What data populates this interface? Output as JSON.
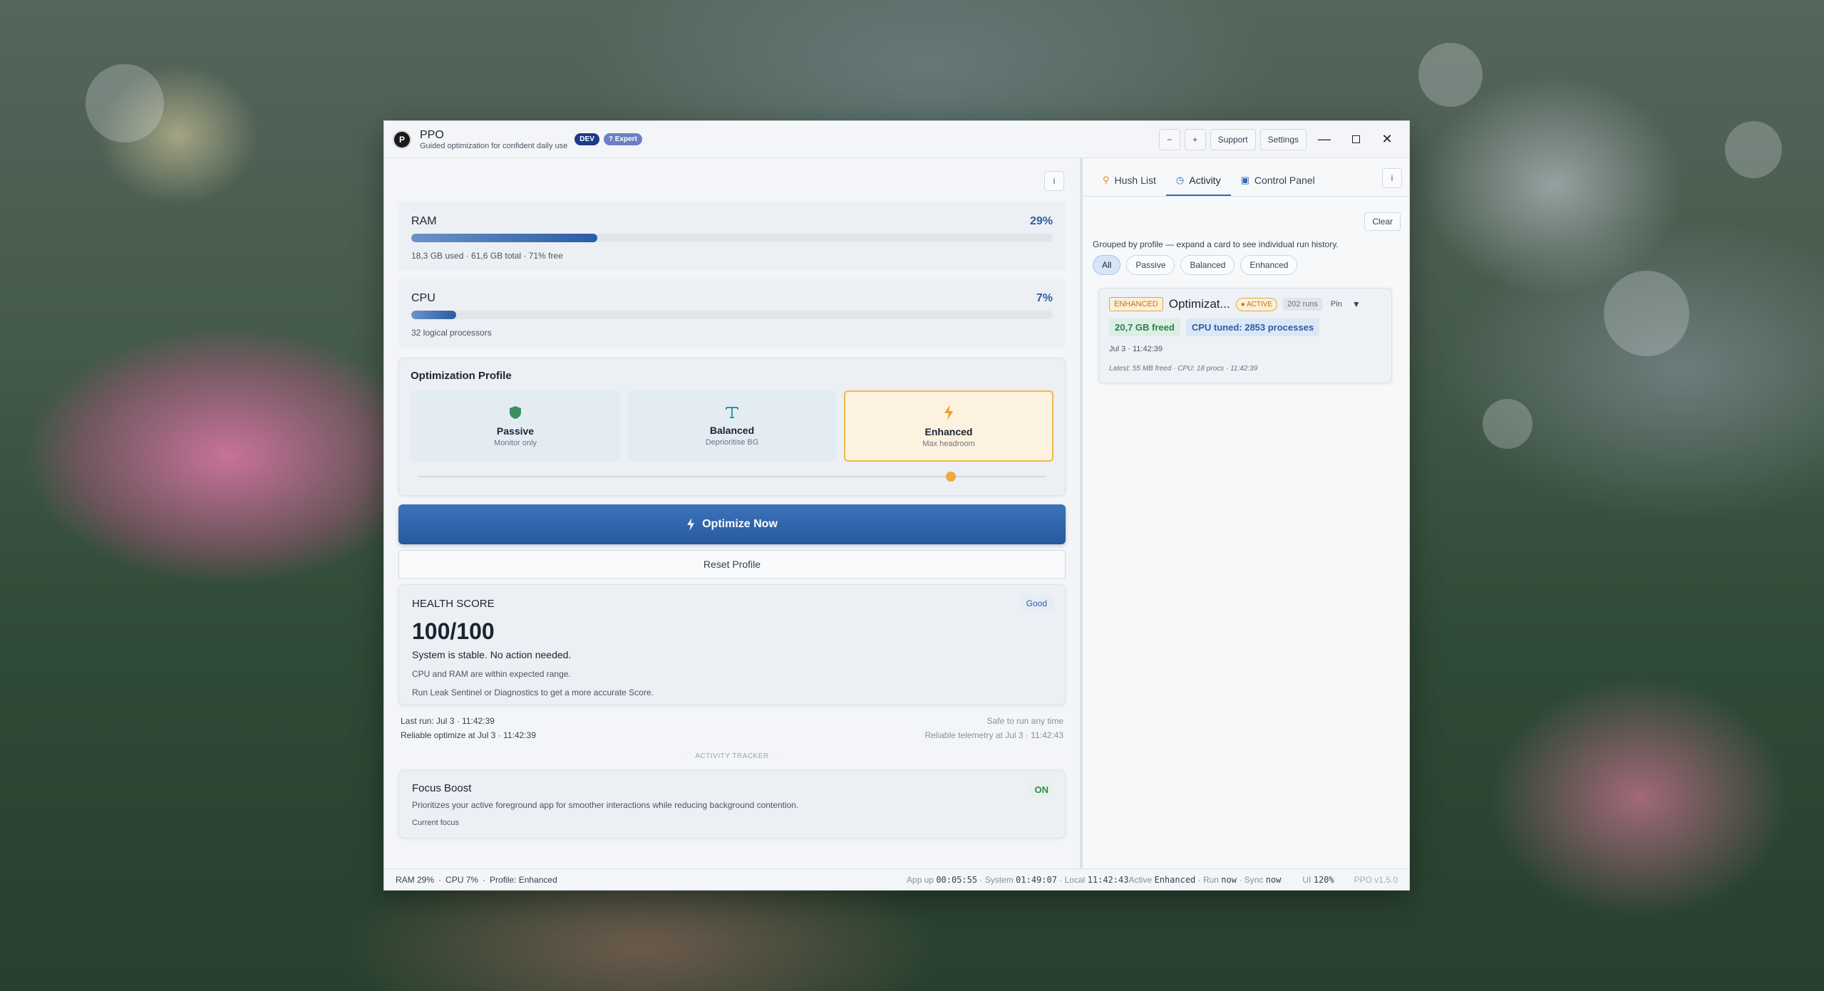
{
  "window": {
    "app_name": "PPO",
    "logo_letter": "P",
    "subtitle": "Guided optimization for confident daily use",
    "badge_dev": "DEV",
    "badge_expert": "? Expert",
    "zoom_out": "−",
    "zoom_in": "+",
    "support": "Support",
    "settings": "Settings"
  },
  "left": {
    "info": "i",
    "ram": {
      "label": "RAM",
      "percent": "29%",
      "fill": 0.29,
      "detail": "18,3 GB used  ·  61,6 GB total  ·  71% free"
    },
    "cpu": {
      "label": "CPU",
      "percent": "7%",
      "fill": 0.07,
      "detail": "32 logical processors"
    },
    "profile": {
      "title": "Optimization Profile",
      "options": [
        {
          "name": "Passive",
          "sub": "Monitor only",
          "icon": "shield-icon"
        },
        {
          "name": "Balanced",
          "sub": "Deprioritise BG",
          "icon": "text-icon"
        },
        {
          "name": "Enhanced",
          "sub": "Max headroom",
          "icon": "bolt-icon"
        }
      ],
      "selected": "Enhanced",
      "slider_level": 0.85
    },
    "optimize_label": "Optimize Now",
    "reset_label": "Reset Profile",
    "health": {
      "title": "HEALTH SCORE",
      "badge": "Good",
      "score": "100/100",
      "line1": "System is stable. No action needed.",
      "line2": "CPU and RAM are within expected range.",
      "line3": "Run Leak Sentinel or Diagnostics to get a more accurate Score."
    },
    "run": {
      "last_run": "Last run: Jul 3 · 11:42:39",
      "reliable_opt": "Reliable optimize at Jul 3 · 11:42:39",
      "safe": "Safe to run any time",
      "telemetry": "Reliable telemetry at Jul 3 · 11:42:43"
    },
    "divider": "ACTIVITY TRACKER",
    "focus": {
      "title": "Focus Boost",
      "state": "ON",
      "desc": "Prioritizes your active foreground app for smoother interactions while reducing background contention.",
      "current": "Current focus"
    }
  },
  "right": {
    "tabs": [
      "Hush List",
      "Activity",
      "Control Panel"
    ],
    "active_tab": "Activity",
    "info": "i",
    "clear": "Clear",
    "grouped_text": "Grouped by profile — expand a card to see individual run history.",
    "filters": [
      "All",
      "Passive",
      "Balanced",
      "Enhanced"
    ],
    "active_filter": "All",
    "card": {
      "profile_tag": "ENHANCED",
      "name": "Optimizat...",
      "active_tag": "● ACTIVE",
      "runs": "202 runs",
      "pin": "Pin",
      "expand": "▼",
      "freed": "20,7 GB freed",
      "cpu": "CPU tuned: 2853 processes",
      "date": "Jul 3 · 11:42:39",
      "latest": "Latest: 55 MB freed · CPU: 18 procs · 11:42:39"
    }
  },
  "status": {
    "ram": "RAM 29%",
    "cpu": "CPU 7%",
    "profile": "Profile: Enhanced",
    "app_up_label": "App up",
    "app_up": "00:05:55",
    "system_label": "System",
    "system": "01:49:07",
    "local_label": "Local",
    "local": "11:42:43",
    "active_label": "Active",
    "active": "Enhanced",
    "run_label": "Run",
    "run": "now",
    "sync_label": "Sync",
    "sync": "now",
    "ui_label": "UI",
    "ui": "120%",
    "version": "PPO v1.5.0"
  },
  "colors": {
    "accent": "#2b5ea8",
    "enhanced": "#f2a93b",
    "good": "#2e8b57"
  }
}
